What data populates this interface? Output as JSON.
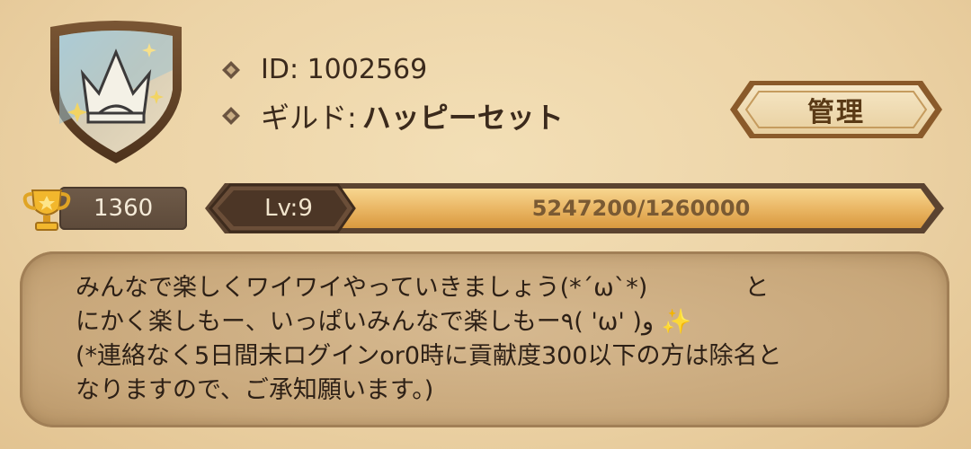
{
  "profile": {
    "id_text": "ID: 1002569",
    "guild_label": "ギルド:",
    "guild_name": "ハッピーセット"
  },
  "manage_button": {
    "label": "管理"
  },
  "score": {
    "value": "1360"
  },
  "level": {
    "label": "Lv:9",
    "progress_text": "5247200/1260000",
    "progress_fraction": 1.0
  },
  "message": {
    "lines": [
      "みんなで楽しくワイワイやっていきましょう(*´ω`*)　　　　と",
      "にかく楽しもー、いっぱいみんなで楽しもー٩( 'ω' )و ✨",
      "(*連絡なく5日間未ログインor0時に貢献度300以下の方は除名と",
      "なりますので、ご承知願います。)"
    ]
  },
  "colors": {
    "background": "#ecd3a6",
    "button_fill": "#f0dcb2",
    "progress_fill": "#e9b35c",
    "message_bg": "#c8a77a"
  },
  "icons": {
    "emblem": "guild-crown-shield-icon",
    "bullet": "diamond-bullet-icon",
    "trophy": "trophy-icon"
  }
}
